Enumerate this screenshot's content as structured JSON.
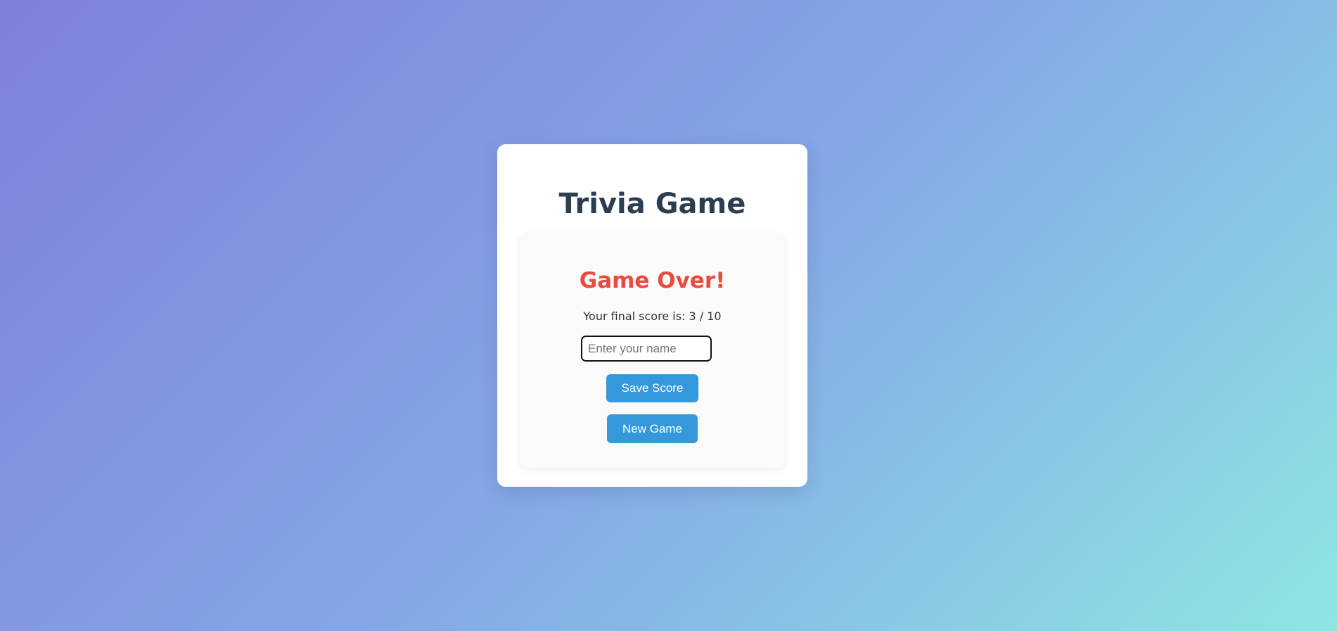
{
  "app": {
    "title": "Trivia Game"
  },
  "result": {
    "heading": "Game Over!",
    "score_label": "Your final score is:",
    "score": 3,
    "total": 10,
    "score_text": "Your final score is: 3 / 10"
  },
  "name_input": {
    "value": "",
    "placeholder": "Enter your name"
  },
  "buttons": {
    "save_label": "Save Score",
    "new_game_label": "New Game"
  },
  "colors": {
    "title": "#2c3e50",
    "game_over": "#e74c3c",
    "button": "#3498db",
    "background_start": "#7f7fd9",
    "background_end": "#8ee6e2"
  }
}
